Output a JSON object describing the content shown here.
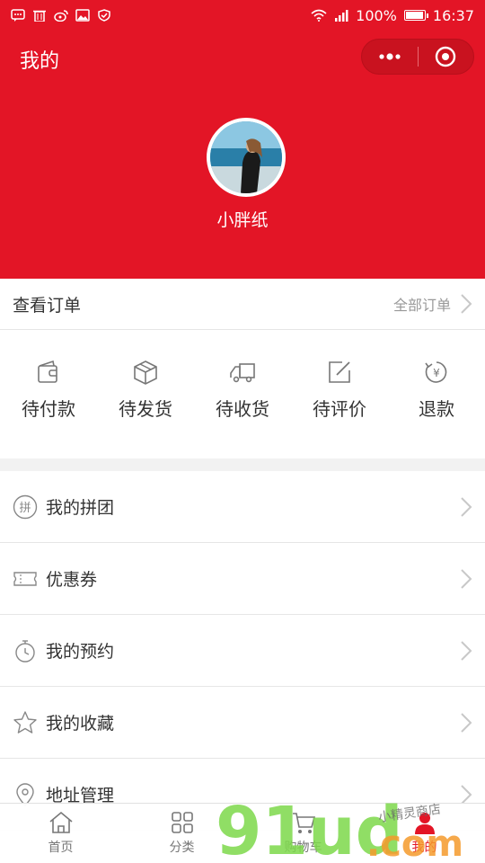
{
  "status_bar": {
    "battery": "100%",
    "time": "16:37",
    "battery_level": 1.0
  },
  "header": {
    "title": "我的",
    "username": "小胖纸",
    "accent_color": "#e31526"
  },
  "orders": {
    "title": "查看订单",
    "all_label": "全部订单",
    "items": [
      {
        "label": "待付款",
        "icon": "wallet-icon"
      },
      {
        "label": "待发货",
        "icon": "box-icon"
      },
      {
        "label": "待收货",
        "icon": "truck-icon"
      },
      {
        "label": "待评价",
        "icon": "edit-icon"
      },
      {
        "label": "退款",
        "icon": "refund-icon"
      }
    ]
  },
  "menu": {
    "items": [
      {
        "label": "我的拼团",
        "icon": "group-buy-icon",
        "badge": "拼"
      },
      {
        "label": "优惠券",
        "icon": "coupon-icon"
      },
      {
        "label": "我的预约",
        "icon": "stopwatch-icon"
      },
      {
        "label": "我的收藏",
        "icon": "star-icon"
      },
      {
        "label": "地址管理",
        "icon": "location-pin-icon"
      }
    ]
  },
  "tabbar": {
    "items": [
      {
        "label": "首页",
        "icon": "home-icon",
        "active": false
      },
      {
        "label": "分类",
        "icon": "category-icon",
        "active": false
      },
      {
        "label": "购物车",
        "icon": "cart-icon",
        "active": false
      },
      {
        "label": "我的",
        "icon": "user-icon",
        "active": true
      }
    ]
  },
  "watermark": {
    "brand": "91ud",
    "domain": ".com",
    "tagline": "小精灵商店"
  }
}
